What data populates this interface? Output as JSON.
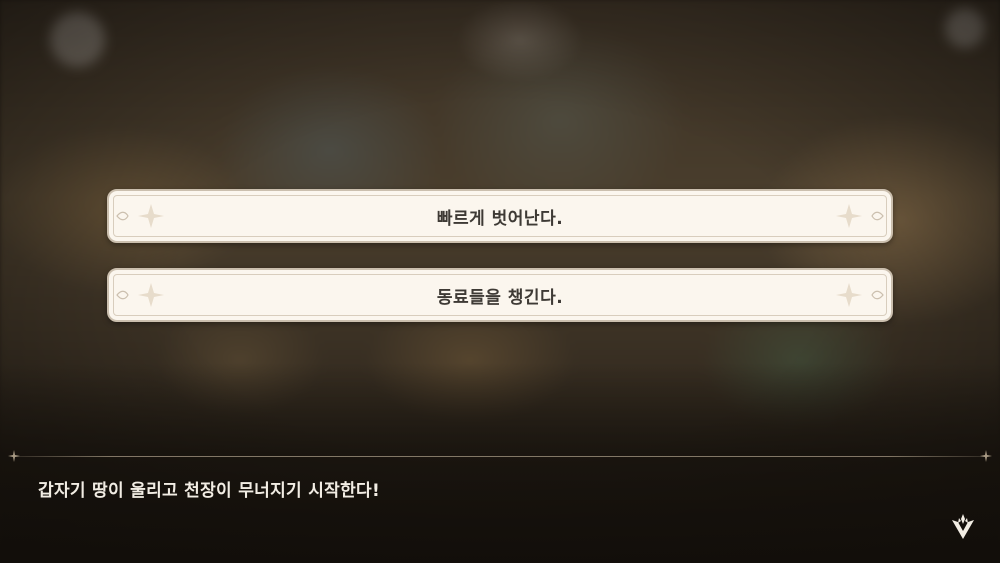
{
  "choices": [
    {
      "label": "빠르게 벗어난다."
    },
    {
      "label": "동료들을 챙긴다."
    }
  ],
  "dialogue": {
    "text": "갑자기 땅이 울리고 천장이 무너지기 시작한다!"
  },
  "icons": {
    "ornament": "sparkle-ornament-icon",
    "next": "advance-arrow-icon",
    "divider_star": "four-point-star-icon"
  },
  "colors": {
    "choice_bg": "#fbf6ee",
    "choice_border": "#cbbfae",
    "choice_text": "#3e3a35",
    "dialogue_text": "#f2ede4"
  }
}
